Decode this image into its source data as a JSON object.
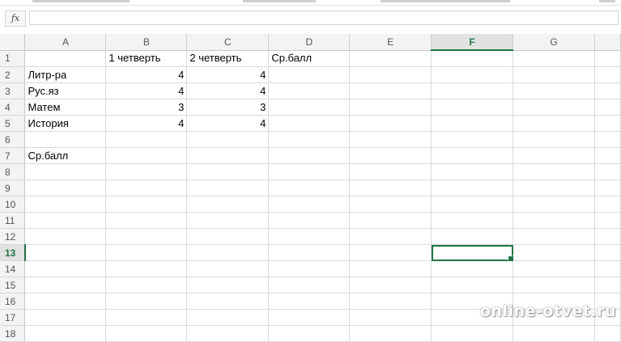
{
  "formula_bar": {
    "fx_label": "fx",
    "value": ""
  },
  "columns": [
    "A",
    "B",
    "C",
    "D",
    "E",
    "F",
    "G",
    ""
  ],
  "selected_column": "F",
  "selected_row": 13,
  "row_numbers": [
    1,
    2,
    3,
    4,
    5,
    6,
    7,
    8,
    9,
    10,
    11,
    12,
    13,
    14,
    15,
    16,
    17,
    18
  ],
  "cells": {
    "B1": "1 четверть",
    "C1": "2 четверть",
    "D1": "Ср.балл",
    "A2": "Литр-ра",
    "B2": "4",
    "C2": "4",
    "A3": "Рус.яз",
    "B3": "4",
    "C3": "4",
    "A4": "Матем",
    "B4": "3",
    "C4": "3",
    "A5": "История",
    "B5": "4",
    "C5": "4",
    "A7": "Ср.балл"
  },
  "watermark": "online-otvet.ru"
}
